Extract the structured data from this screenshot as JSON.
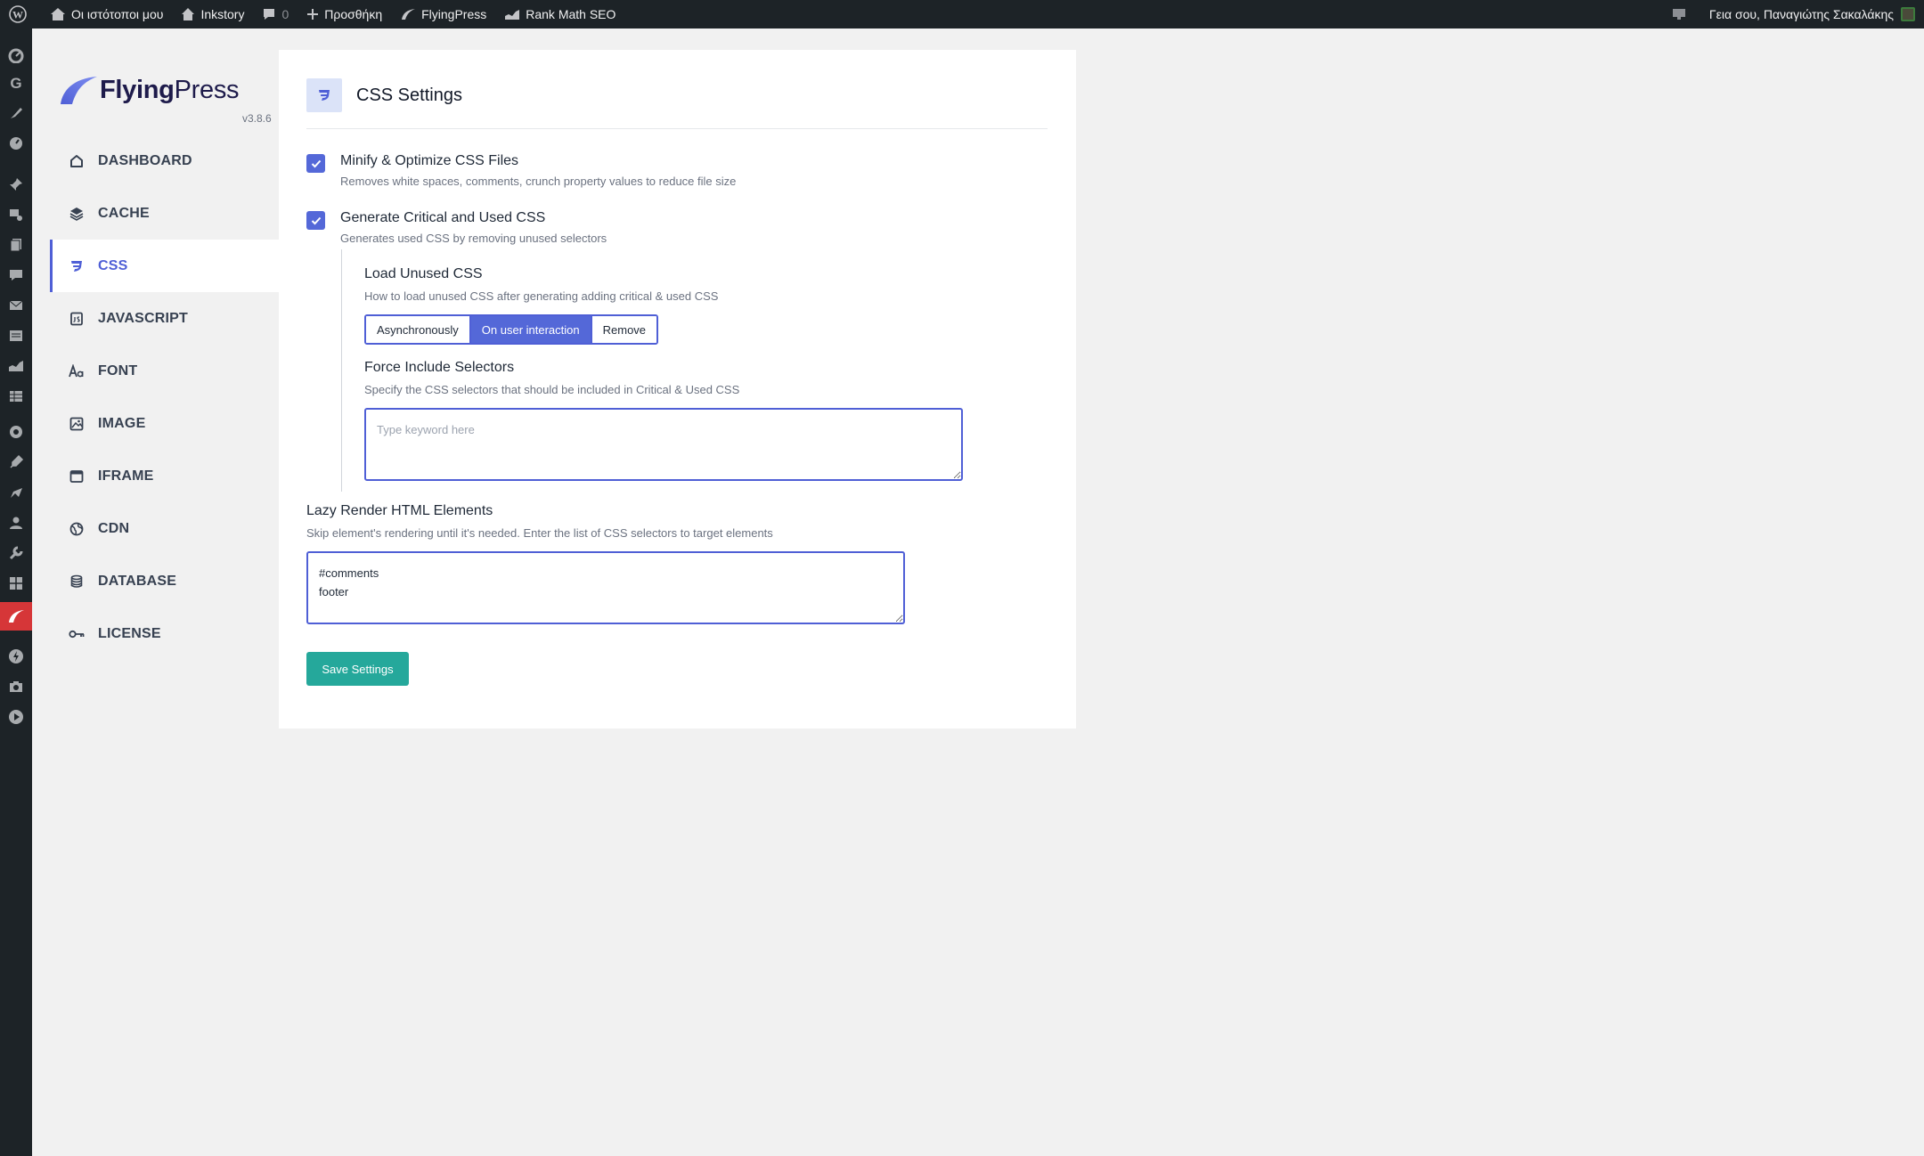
{
  "admin_bar": {
    "my_sites": "Οι ιστότοποι μου",
    "site_name": "Inkstory",
    "comments_count": "0",
    "new_label": "Προσθήκη",
    "flyingpress": "FlyingPress",
    "rank_math": "Rank Math SEO",
    "greeting": "Γεια σου, Παναγιώτης Σακαλάκης"
  },
  "plugin": {
    "logo_bold": "Flying",
    "logo_light": "Press",
    "version": "v3.8.6",
    "accent_color": "#4f5fd6"
  },
  "nav": [
    {
      "label": "DASHBOARD",
      "icon": "home-icon"
    },
    {
      "label": "CACHE",
      "icon": "layers-icon"
    },
    {
      "label": "CSS",
      "icon": "css3-icon",
      "active": true
    },
    {
      "label": "JAVASCRIPT",
      "icon": "js-file-icon"
    },
    {
      "label": "FONT",
      "icon": "font-icon"
    },
    {
      "label": "IMAGE",
      "icon": "image-icon"
    },
    {
      "label": "IFRAME",
      "icon": "iframe-icon"
    },
    {
      "label": "CDN",
      "icon": "globe-icon"
    },
    {
      "label": "DATABASE",
      "icon": "database-icon"
    },
    {
      "label": "LICENSE",
      "icon": "key-icon"
    }
  ],
  "page": {
    "title": "CSS Settings",
    "minify": {
      "title": "Minify & Optimize CSS Files",
      "desc": "Removes white spaces, comments, crunch property values to reduce file size",
      "checked": true
    },
    "critical": {
      "title": "Generate Critical and Used CSS",
      "desc": "Generates used CSS by removing unused selectors",
      "checked": true
    },
    "load_unused": {
      "title": "Load Unused CSS",
      "desc": "How to load unused CSS after generating adding critical & used CSS",
      "options": [
        "Asynchronously",
        "On user interaction",
        "Remove"
      ],
      "selected": "On user interaction"
    },
    "force_include": {
      "title": "Force Include Selectors",
      "desc": "Specify the CSS selectors that should be included in Critical & Used CSS",
      "placeholder": "Type keyword here",
      "value": ""
    },
    "lazy_render": {
      "title": "Lazy Render HTML Elements",
      "desc": "Skip element's rendering until it's needed. Enter the list of CSS selectors to target elements",
      "value": "#comments\nfooter"
    },
    "save_label": "Save Settings"
  }
}
